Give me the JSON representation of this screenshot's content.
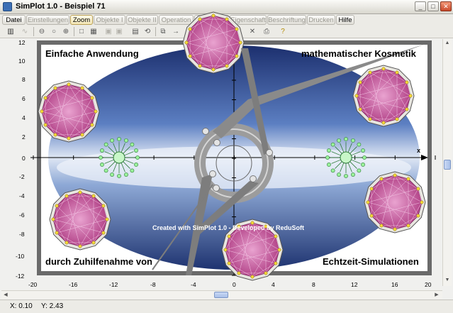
{
  "window": {
    "title": "SimPlot 1.0 - Beispiel 71"
  },
  "menu": [
    {
      "label": "Datei",
      "enabled": true
    },
    {
      "label": "Einstellungen",
      "enabled": false
    },
    {
      "label": "Zoom",
      "enabled": true
    },
    {
      "label": "Objekte I",
      "enabled": false
    },
    {
      "label": "Objekte II",
      "enabled": false
    },
    {
      "label": "Operation",
      "enabled": false
    },
    {
      "label": "Darstellen",
      "enabled": false
    },
    {
      "label": "Eigenschaft",
      "enabled": false
    },
    {
      "label": "Beschriftung",
      "enabled": false
    },
    {
      "label": "Drucken",
      "enabled": false
    },
    {
      "label": "Hilfe",
      "enabled": true
    }
  ],
  "toolbar_icons": [
    "calculator-icon",
    "function-icon",
    "zoom-out-icon",
    "zoom-icon",
    "zoom-in-icon",
    "select-rect-icon",
    "grid-icon",
    "object-icon",
    "object-alt-icon",
    "table-icon",
    "refresh-icon",
    "copy-icon",
    "arrow-right-icon",
    "arrow-left-icon",
    "page-icon",
    "delete-icon",
    "delete-alt-icon",
    "print-icon",
    "help-icon"
  ],
  "plot": {
    "x_ticks": [
      "-20",
      "-16",
      "-12",
      "-8",
      "-4",
      "0",
      "4",
      "8",
      "12",
      "16",
      "20"
    ],
    "y_ticks": [
      "12",
      "10",
      "8",
      "6",
      "4",
      "2",
      "0",
      "-2",
      "-4",
      "-6",
      "-8",
      "-10",
      "-12"
    ],
    "x_axis_label": "x",
    "texts": {
      "top_left": "Einfache Anwendung",
      "top_right": "mathematischer Kosmetik",
      "bottom_left": "durch Zuhilfenahme von",
      "bottom_right": "Echtzeit-Simulationen",
      "credit": "Created with SimPlot 1.0 - Developed by ReduSoft"
    },
    "colors": {
      "frame": "#6a6a6a",
      "polygon": "#b0408a",
      "star": "#2e9a3a",
      "ellipse": "#3a4f8a",
      "clock": "#9a9a9a"
    }
  },
  "status": {
    "x": "X: 0.10",
    "y": "Y: 2.43"
  }
}
